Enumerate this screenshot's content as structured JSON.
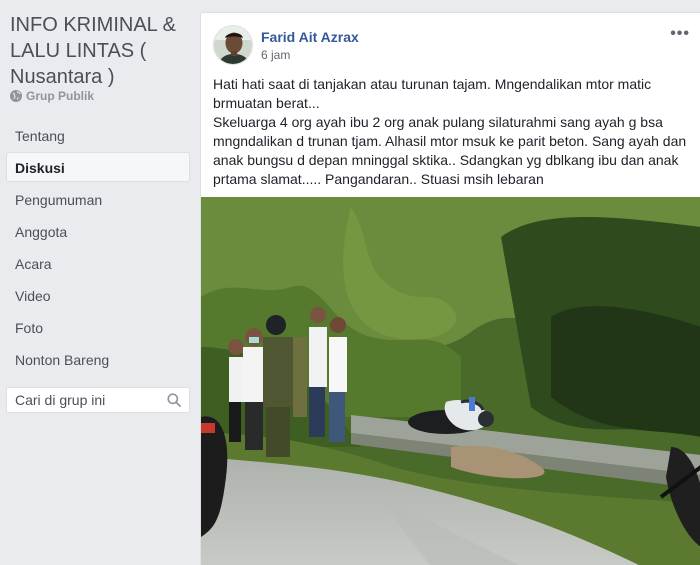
{
  "group": {
    "title": "INFO KRIMINAL & LALU LINTAS ( Nusantara )",
    "type": "Grup Publik"
  },
  "nav": {
    "items": [
      {
        "label": "Tentang"
      },
      {
        "label": "Diskusi",
        "active": true
      },
      {
        "label": "Pengumuman"
      },
      {
        "label": "Anggota"
      },
      {
        "label": "Acara"
      },
      {
        "label": "Video"
      },
      {
        "label": "Foto"
      },
      {
        "label": "Nonton Bareng"
      }
    ]
  },
  "search": {
    "placeholder": "Cari di grup ini",
    "icon": "search-icon"
  },
  "post": {
    "author": "Farid Ait Azrax",
    "time": "6 jam",
    "more": "•••",
    "lines": [
      "Hati hati saat di tanjakan atau turunan tajam. Mngendalikan mtor matic brmuatan berat...",
      "Skeluarga 4 org ayah ibu 2 org anak pulang silaturahmi sang ayah g bsa mngndalikan d trunan tjam. Alhasil mtor msuk ke parit beton. Sang ayah dan anak bungsu d depan mninggal sktika.. Sdangkan yg dblkang ibu dan anak prtama slamat..... Pangandaran.. Stuasi msih lebaran"
    ]
  },
  "colors": {
    "background": "#e9ebee",
    "link": "#365899",
    "text": "#1d2129"
  }
}
